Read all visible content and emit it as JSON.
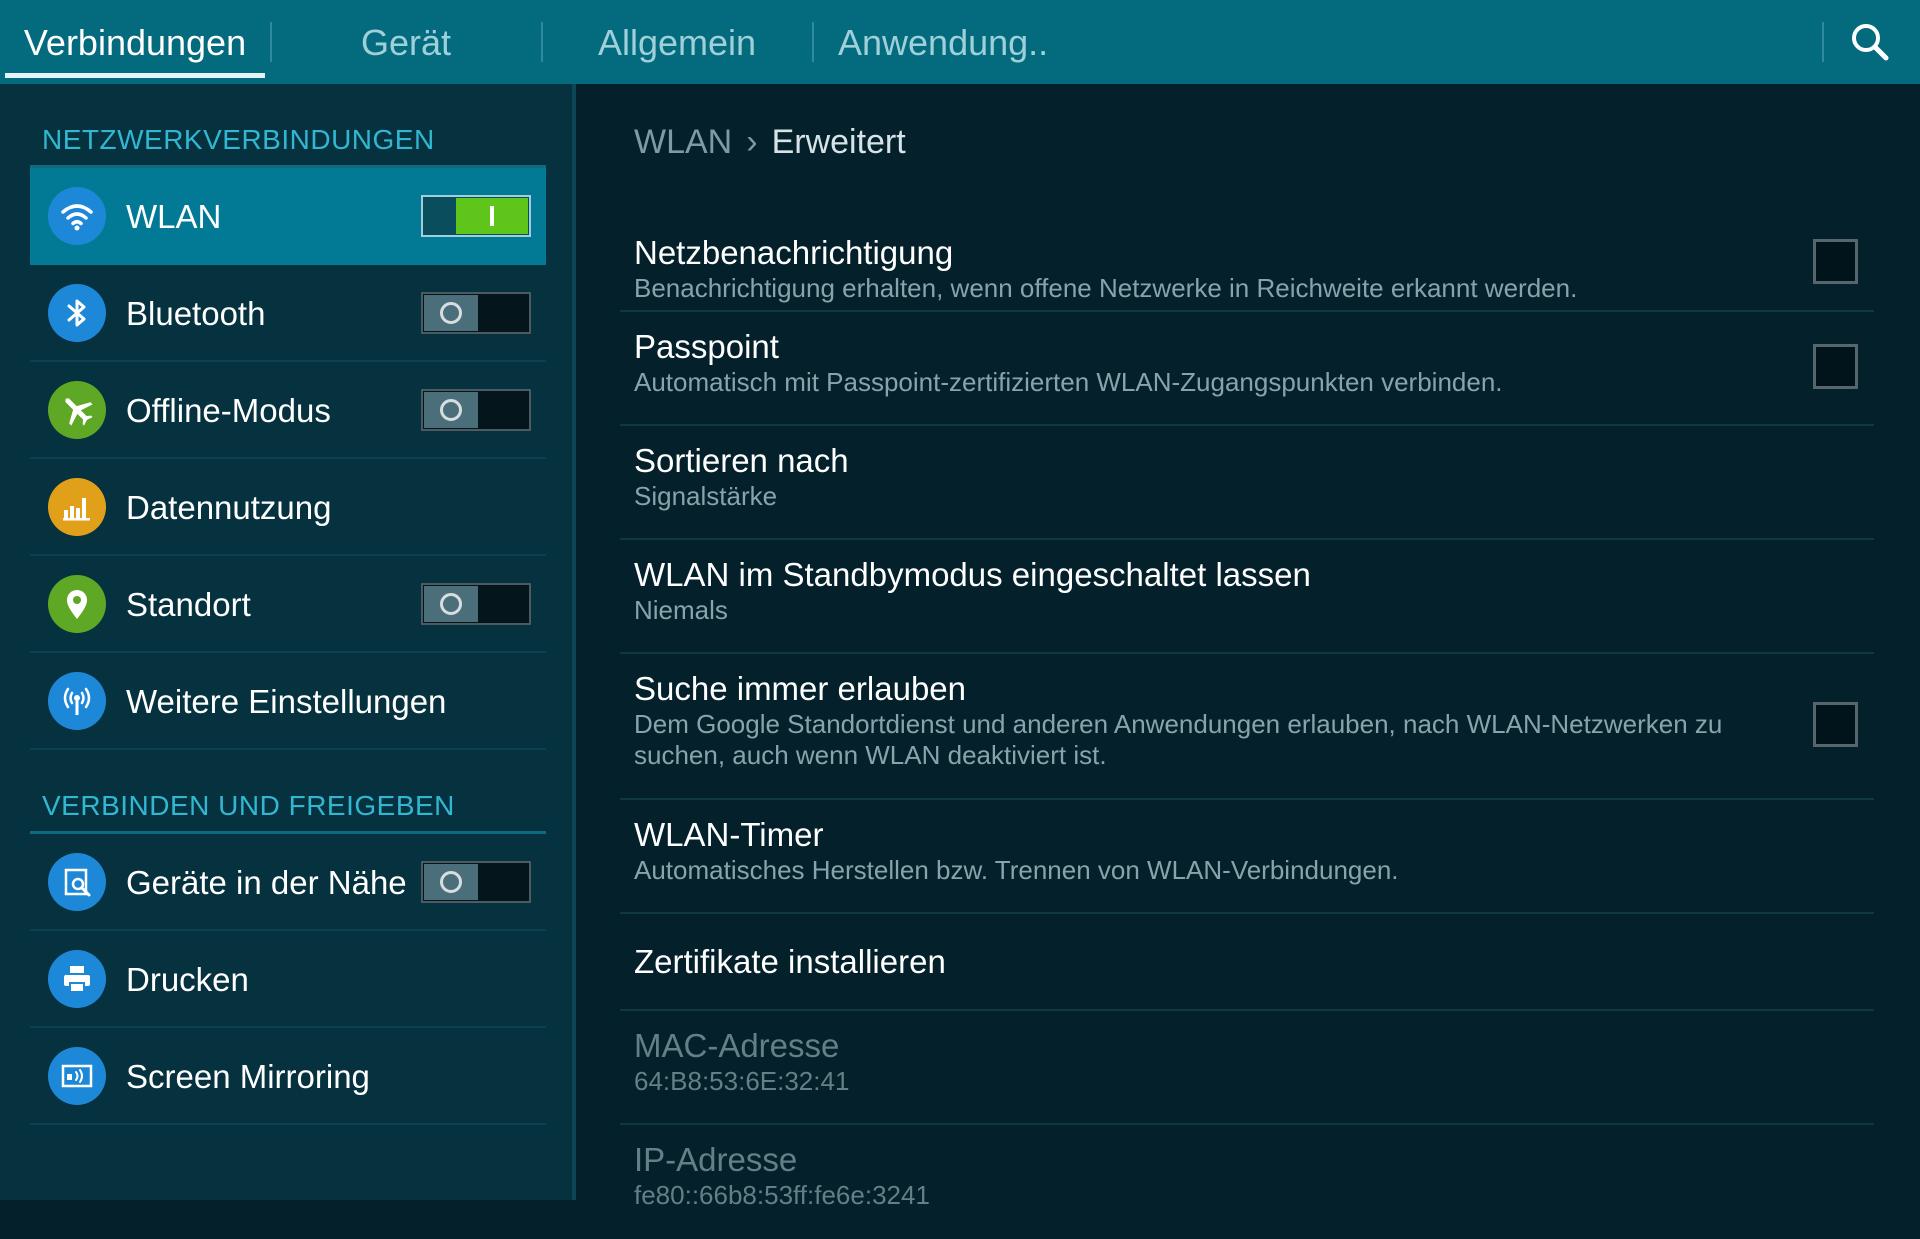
{
  "tabs": [
    {
      "label": "Verbindungen",
      "active": true
    },
    {
      "label": "Gerät",
      "active": false
    },
    {
      "label": "Allgemein",
      "active": false
    },
    {
      "label": "Anwendung..",
      "active": false
    }
  ],
  "search_icon": "search-icon",
  "sidebar": {
    "section1": "NETZWERKVERBINDUNGEN",
    "section2": "VERBINDEN UND FREIGEBEN",
    "items": [
      {
        "label": "WLAN",
        "icon": "wifi-icon",
        "icon_color": "#1e88d8",
        "toggle": "on",
        "active": true
      },
      {
        "label": "Bluetooth",
        "icon": "bluetooth-icon",
        "icon_color": "#1e88d8",
        "toggle": "off"
      },
      {
        "label": "Offline-Modus",
        "icon": "airplane-icon",
        "icon_color": "#5ea825",
        "toggle": "off"
      },
      {
        "label": "Datennutzung",
        "icon": "data-usage-icon",
        "icon_color": "#e0a019"
      },
      {
        "label": "Standort",
        "icon": "location-pin-icon",
        "icon_color": "#5ea825",
        "toggle": "off"
      },
      {
        "label": "Weitere Einstellungen",
        "icon": "more-networks-icon",
        "icon_color": "#1e88d8"
      },
      {
        "label": "Geräte in der Nähe",
        "icon": "nearby-devices-icon",
        "icon_color": "#1e88d8",
        "toggle": "off"
      },
      {
        "label": "Drucken",
        "icon": "printer-icon",
        "icon_color": "#1e88d8"
      },
      {
        "label": "Screen Mirroring",
        "icon": "screen-mirroring-icon",
        "icon_color": "#1e88d8"
      }
    ]
  },
  "breadcrumb": {
    "parent": "WLAN",
    "separator": "›",
    "current": "Erweitert"
  },
  "settings": [
    {
      "title": "Netzbenachrichtigung",
      "subtitle": "Benachrichtigung erhalten, wenn offene Netzwerke in Reichweite erkannt werden.",
      "checkbox": false
    },
    {
      "title": "Passpoint",
      "subtitle": "Automatisch mit Passpoint-zertifizierten WLAN-Zugangspunkten verbinden.",
      "checkbox": false
    },
    {
      "title": "Sortieren nach",
      "subtitle": "Signalstärke"
    },
    {
      "title": "WLAN im Standbymodus eingeschaltet lassen",
      "subtitle": "Niemals"
    },
    {
      "title": "Suche immer erlauben",
      "subtitle": "Dem Google Standortdienst und anderen Anwendungen erlauben, nach WLAN-Netzwerken zu suchen, auch wenn WLAN deaktiviert ist.",
      "checkbox": false
    },
    {
      "title": "WLAN-Timer",
      "subtitle": "Automatisches Herstellen bzw. Trennen von WLAN-Verbindungen."
    },
    {
      "title": "Zertifikate installieren"
    },
    {
      "title": "MAC-Adresse",
      "subtitle": "64:B8:53:6E:32:41",
      "disabled": true
    },
    {
      "title": "IP-Adresse",
      "subtitle": "fe80::66b8:53ff:fe6e:3241",
      "disabled": true
    }
  ]
}
